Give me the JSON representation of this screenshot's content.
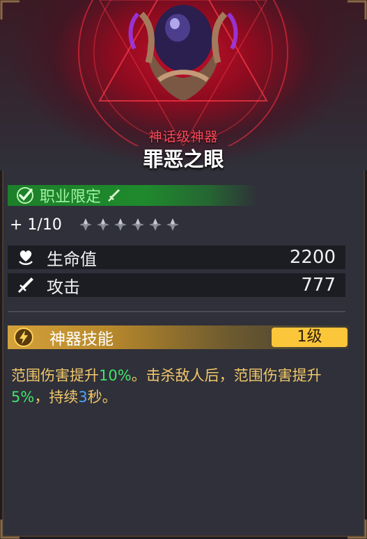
{
  "item": {
    "rarity": "神话级神器",
    "name": "罪恶之眼"
  },
  "class_restriction": {
    "label": "职业限定",
    "met": true,
    "class_icon": "sword-icon"
  },
  "enhance": {
    "text": "+ 1/10",
    "level": 1,
    "max": 10,
    "star_count": 6
  },
  "stats": [
    {
      "icon": "heart-icon",
      "label": "生命值",
      "value": "2200"
    },
    {
      "icon": "sword-icon",
      "label": "攻击",
      "value": "777"
    }
  ],
  "skill": {
    "icon": "lightning-icon",
    "label": "神器技能",
    "level": "1级",
    "description": [
      {
        "text": "范围伤害提升",
        "style": "normal"
      },
      {
        "text": "10%",
        "style": "green"
      },
      {
        "text": "。击杀敌人后，范围伤害提升",
        "style": "normal"
      },
      {
        "text": "5%",
        "style": "green"
      },
      {
        "text": "，持续",
        "style": "normal"
      },
      {
        "text": "3",
        "style": "blue"
      },
      {
        "text": "秒。",
        "style": "normal"
      }
    ]
  },
  "colors": {
    "rarity": "#ff4a5a",
    "class_bar": "#1f8a2d",
    "level_badge": "#fbc63a",
    "description": "#f2c86a",
    "highlight_green": "#43e36b",
    "highlight_blue": "#4da3ff"
  }
}
